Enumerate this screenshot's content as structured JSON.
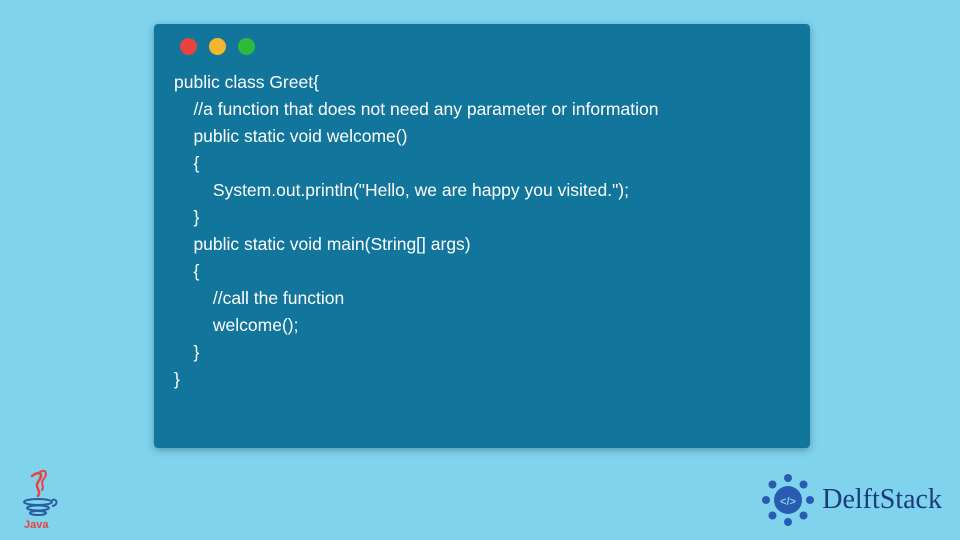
{
  "code": {
    "lines": [
      "public class Greet{",
      "    //a function that does not need any parameter or information",
      "    public static void welcome()",
      "    {",
      "        System.out.println(\"Hello, we are happy you visited.\");",
      "    }",
      "    public static void main(String[] args)",
      "    {",
      "        //call the function",
      "        welcome();",
      "    }",
      "}"
    ]
  },
  "branding": {
    "java_label": "Java",
    "delftstack_label": "DelftStack"
  },
  "window": {
    "traffic_colors": {
      "red": "#e8433f",
      "yellow": "#f4b62f",
      "green": "#2dbb3f"
    }
  }
}
